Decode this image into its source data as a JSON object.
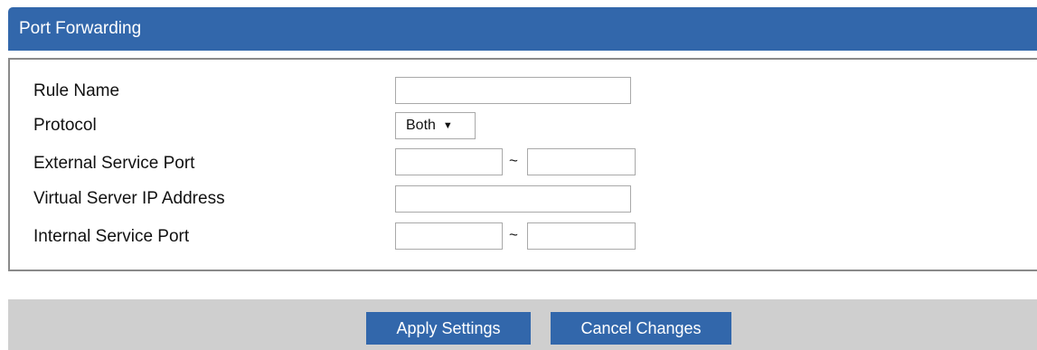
{
  "panel": {
    "title": "Port Forwarding"
  },
  "form": {
    "rule_name": {
      "label": "Rule Name",
      "value": ""
    },
    "protocol": {
      "label": "Protocol",
      "selected": "Both"
    },
    "external_port": {
      "label": "External Service Port",
      "start": "",
      "end": "",
      "separator": "~"
    },
    "virtual_ip": {
      "label": "Virtual Server IP Address",
      "value": ""
    },
    "internal_port": {
      "label": "Internal Service Port",
      "start": "",
      "end": "",
      "separator": "~"
    }
  },
  "footer": {
    "apply_label": "Apply Settings",
    "cancel_label": "Cancel Changes"
  },
  "colors": {
    "header_bg": "#3267ab",
    "button_bg": "#3267ab",
    "footer_bg": "#cfcfcf"
  }
}
